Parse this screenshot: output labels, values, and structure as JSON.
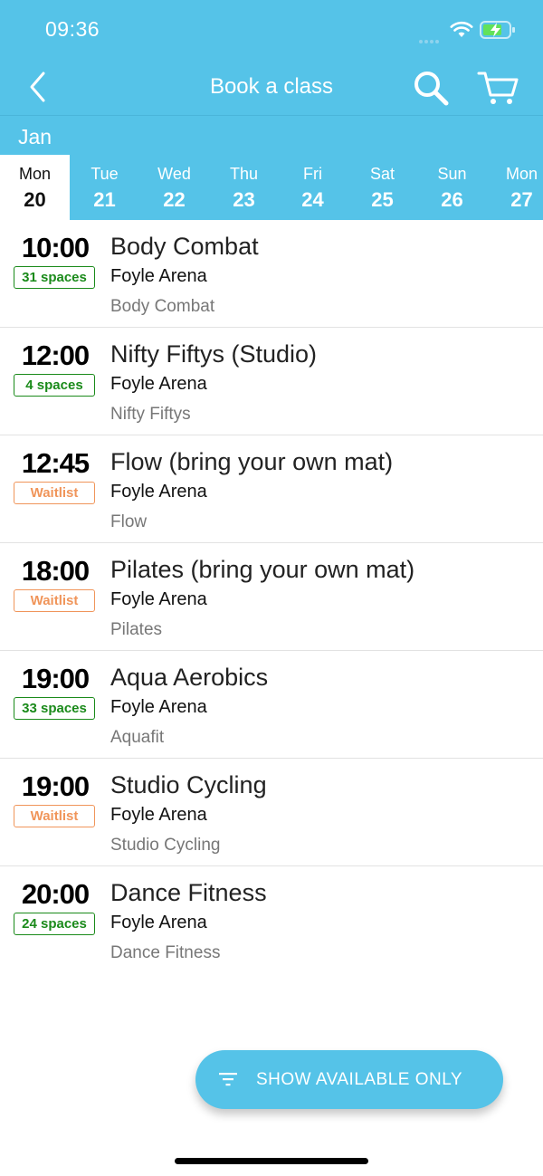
{
  "status_bar": {
    "time": "09:36"
  },
  "nav": {
    "title": "Book a class",
    "back_icon": "chevron-left-icon",
    "search_icon": "search-icon",
    "cart_icon": "cart-icon"
  },
  "calendar": {
    "month": "Jan",
    "days": [
      {
        "name": "Mon",
        "date": "20",
        "selected": true
      },
      {
        "name": "Tue",
        "date": "21"
      },
      {
        "name": "Wed",
        "date": "22"
      },
      {
        "name": "Thu",
        "date": "23"
      },
      {
        "name": "Fri",
        "date": "24"
      },
      {
        "name": "Sat",
        "date": "25"
      },
      {
        "name": "Sun",
        "date": "26"
      },
      {
        "name": "Mon",
        "date": "27"
      }
    ]
  },
  "classes": [
    {
      "time": "10:00",
      "badge": "31 spaces",
      "status": "available",
      "name": "Body Combat",
      "venue": "Foyle Arena",
      "category": "Body Combat"
    },
    {
      "time": "12:00",
      "badge": "4 spaces",
      "status": "available",
      "name": "Nifty Fiftys (Studio)",
      "venue": "Foyle Arena",
      "category": "Nifty Fiftys"
    },
    {
      "time": "12:45",
      "badge": "Waitlist",
      "status": "waitlist",
      "name": "Flow (bring your own mat)",
      "venue": "Foyle Arena",
      "category": "Flow"
    },
    {
      "time": "18:00",
      "badge": "Waitlist",
      "status": "waitlist",
      "name": "Pilates (bring your own mat)",
      "venue": "Foyle Arena",
      "category": "Pilates"
    },
    {
      "time": "19:00",
      "badge": "33 spaces",
      "status": "available",
      "name": "Aqua Aerobics",
      "venue": "Foyle Arena",
      "category": "Aquafit"
    },
    {
      "time": "19:00",
      "badge": "Waitlist",
      "status": "waitlist",
      "name": "Studio Cycling",
      "venue": "Foyle Arena",
      "category": "Studio Cycling"
    },
    {
      "time": "20:00",
      "badge": "24 spaces",
      "status": "available",
      "name": "Dance Fitness",
      "venue": "Foyle Arena",
      "category": "Dance Fitness"
    }
  ],
  "fab": {
    "label": "SHOW AVAILABLE ONLY",
    "icon": "filter-icon"
  },
  "colors": {
    "primary": "#55c3e8",
    "available": "#1a8a1a",
    "waitlist": "#f0955a"
  }
}
